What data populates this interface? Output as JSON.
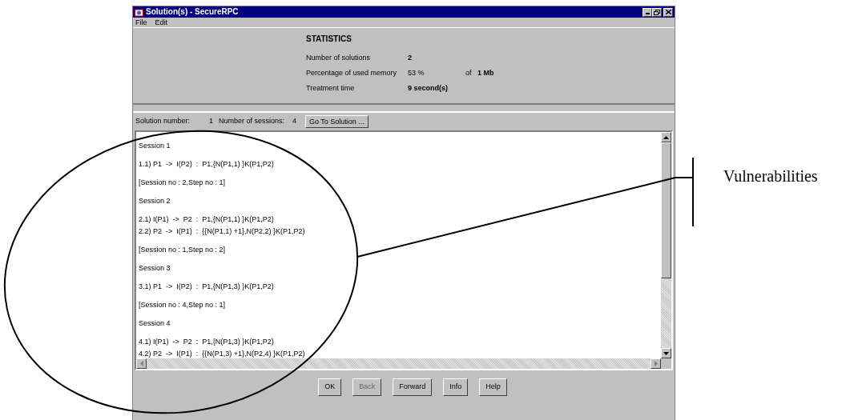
{
  "window": {
    "title": "Solution(s) - SecureRPC"
  },
  "menu": [
    "File",
    "Edit"
  ],
  "statistics": {
    "heading": "STATISTICS",
    "rows": [
      {
        "label": "Number of solutions",
        "value": "2"
      },
      {
        "label": "Percentage of used memory",
        "value": "53 %",
        "of_label": "of",
        "of_value": "1 Mb"
      },
      {
        "label": "Treatment time",
        "value": "9 second(s)"
      }
    ]
  },
  "solution_bar": {
    "solution_label": "Solution number:",
    "solution_value": "1",
    "sessions_label": "Number of sessions:",
    "sessions_value": "4",
    "button": "Go To Solution ..."
  },
  "output_blocks": [
    [
      "Session 1"
    ],
    [
      "1.1) P1  ->  I(P2)  :  P1,{N(P1,1) }K(P1,P2)"
    ],
    [
      "[Session no : 2,Step no : 1]"
    ],
    [
      "Session 2"
    ],
    [
      "2.1) I(P1)  ->  P2  :  P1,{N(P1,1) }K(P1,P2)",
      "2.2) P2  ->  I(P1)  :  {{N(P1,1) +1},N(P2,2) }K(P1,P2)"
    ],
    [
      "[Session no : 1,Step no : 2]"
    ],
    [
      "Session 3"
    ],
    [
      "3.1) P1  ->  I(P2)  :  P1,{N(P1,3) }K(P1,P2)"
    ],
    [
      "[Session no : 4,Step no : 1]"
    ],
    [
      "Session 4"
    ],
    [
      "4.1) I(P1)  ->  P2  :  P1,{N(P1,3) }K(P1,P2)",
      "4.2) P2  ->  I(P1)  :  {{N(P1,3) +1},N(P2,4) }K(P1,P2)"
    ]
  ],
  "buttons": [
    {
      "label": "OK",
      "disabled": false
    },
    {
      "label": "Back",
      "disabled": true
    },
    {
      "label": "Forward",
      "disabled": false
    },
    {
      "label": "Info",
      "disabled": false
    },
    {
      "label": "Help",
      "disabled": false
    }
  ],
  "annotation": {
    "label": "Vulnerabilities"
  }
}
